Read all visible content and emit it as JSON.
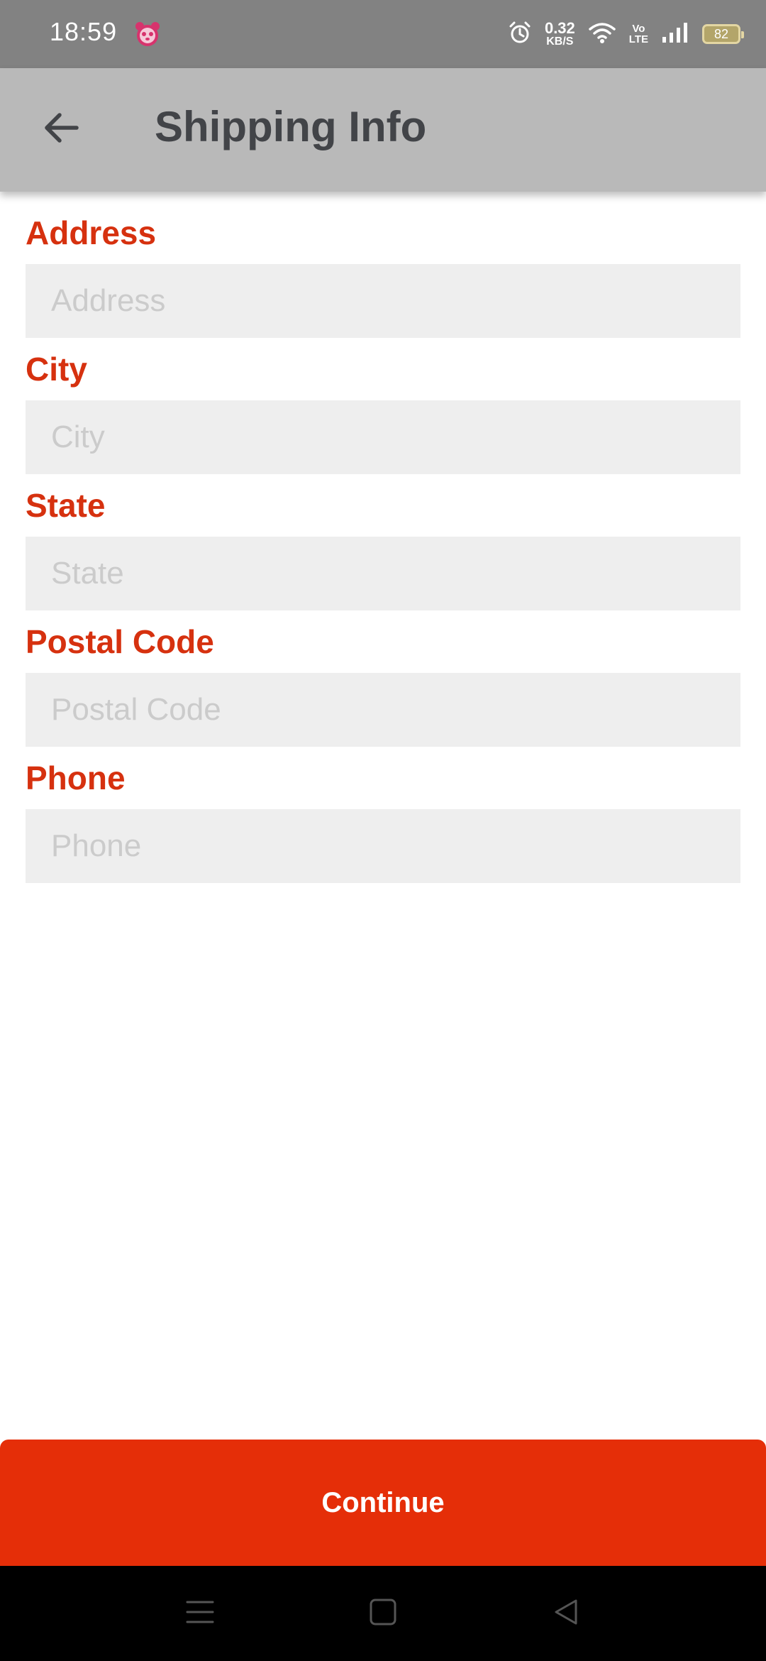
{
  "status_bar": {
    "time": "18:59",
    "net_speed_value": "0.32",
    "net_speed_unit": "KB/S",
    "volte_top": "Vo",
    "volte_bottom": "LTE",
    "battery": "82"
  },
  "header": {
    "title": "Shipping Info",
    "back_icon": "arrow-left-icon"
  },
  "form": {
    "fields": [
      {
        "label": "Address",
        "placeholder": "Address",
        "value": ""
      },
      {
        "label": "City",
        "placeholder": "City",
        "value": ""
      },
      {
        "label": "State",
        "placeholder": "State",
        "value": ""
      },
      {
        "label": "Postal Code",
        "placeholder": "Postal Code",
        "value": ""
      },
      {
        "label": "Phone",
        "placeholder": "Phone",
        "value": ""
      }
    ]
  },
  "actions": {
    "continue_label": "Continue"
  },
  "colors": {
    "accent": "#e52e08",
    "label": "#d6310f",
    "input_bg": "#eeeeee",
    "header_bg": "#b9b9b9"
  },
  "nav": {
    "icons": [
      "menu-icon",
      "home-square-icon",
      "back-triangle-icon"
    ]
  }
}
